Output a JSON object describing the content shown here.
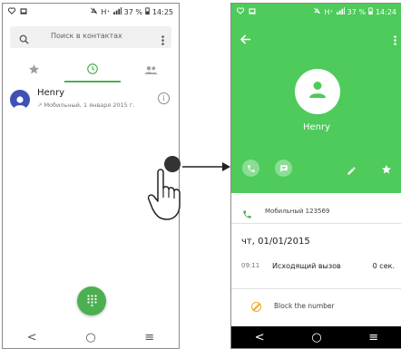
{
  "left_screen": {
    "status": {
      "battery": "37 %",
      "time": "14:25",
      "network": "H⁺"
    },
    "search": {
      "placeholder": "Поиск в контактах"
    },
    "tabs": [
      {
        "name": "favorites",
        "icon": "star-icon"
      },
      {
        "name": "recent",
        "icon": "clock-icon",
        "active": true
      },
      {
        "name": "contacts",
        "icon": "people-icon"
      }
    ],
    "contact": {
      "name": "Henry",
      "detail": "Мобильный, 1 января 2015 г.",
      "call_direction_icon": "outgoing-arrow-icon"
    },
    "fab_icon": "dialpad-icon",
    "nav": {
      "back": "<",
      "home": "○",
      "recent": "≡"
    }
  },
  "right_screen": {
    "status": {
      "battery": "37 %",
      "time": "14:24",
      "network": "H⁺"
    },
    "contact_name": "Henry",
    "phone_entry": "Мобильный 123569",
    "call_date": "чт, 01/01/2015",
    "call": {
      "time": "09:11",
      "type": "Исходящий вызов",
      "duration": "0 сек."
    },
    "block_label": "Block the number",
    "nav": {
      "back": "<",
      "home": "○",
      "recent": "≡"
    }
  },
  "colors": {
    "accent_green": "#4caf50",
    "header_green": "#4ecb5b",
    "avatar_blue": "#3f51b5",
    "block_orange": "#f5a623"
  }
}
